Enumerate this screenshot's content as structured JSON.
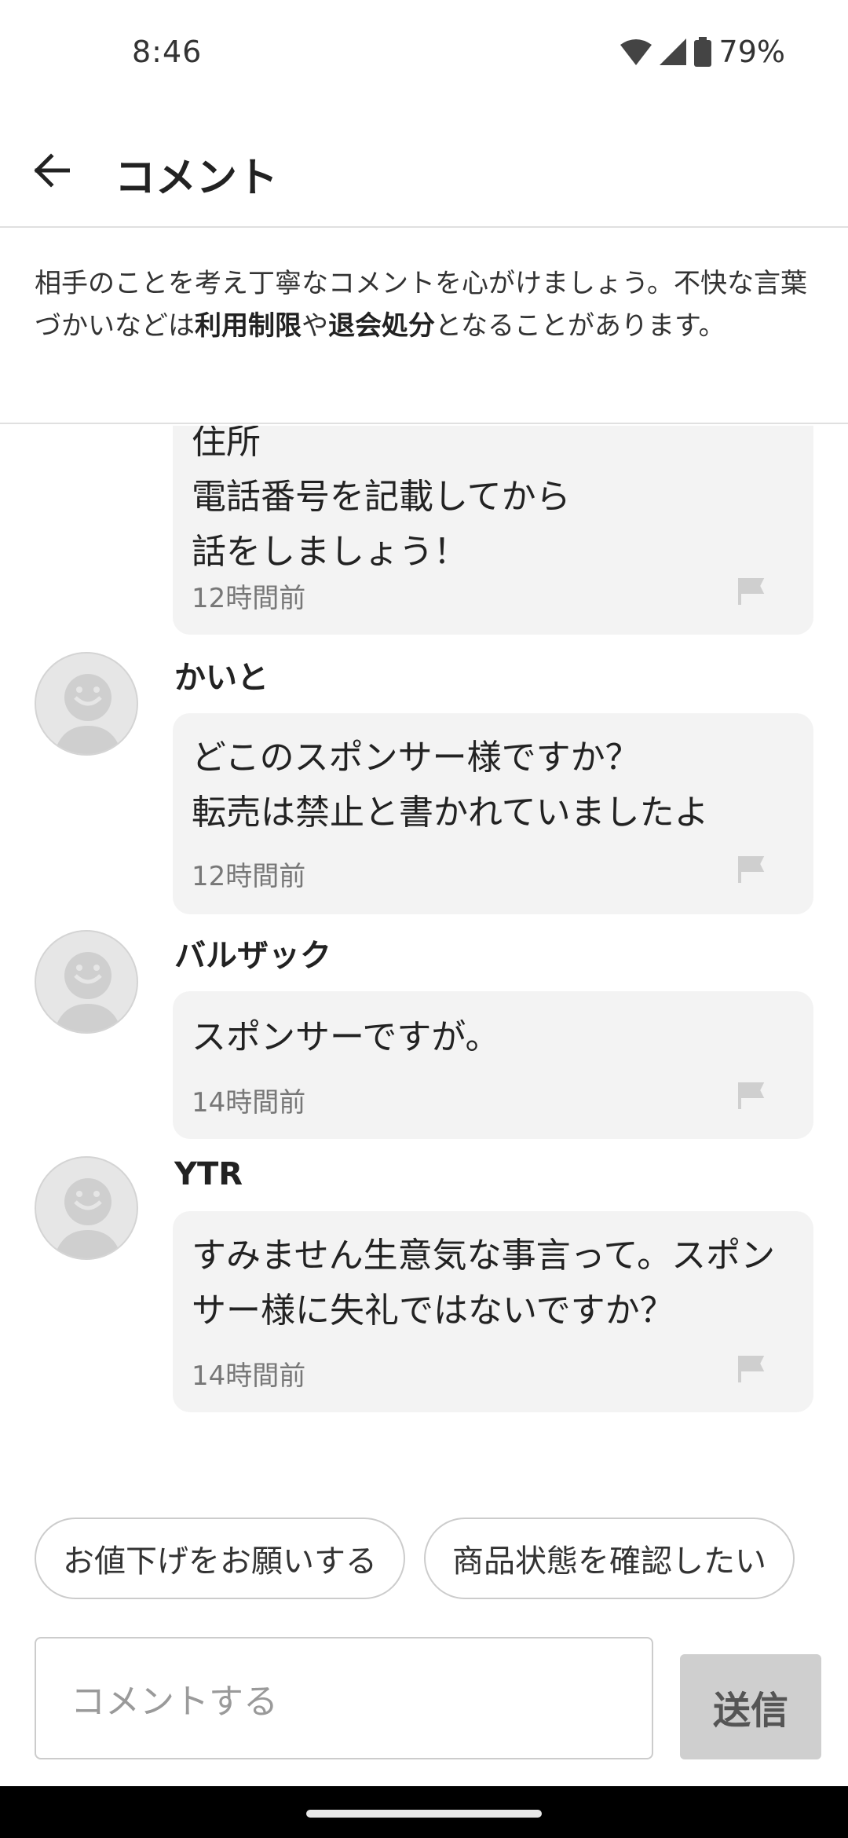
{
  "status_bar": {
    "time": "8:46",
    "battery": "79%"
  },
  "app_bar": {
    "title": "コメント"
  },
  "notice": {
    "part1": "相手のことを考え丁寧なコメントを心がけましょう。不快な言葉づかいなどは",
    "bold1": "利用制限",
    "part2": "や",
    "bold2": "退会処分",
    "part3": "となることがあります。"
  },
  "comments": [
    {
      "username": "",
      "text": "住所\n電話番号を記載してから\n話をしましょう！",
      "time": "12時間前"
    },
    {
      "username": "かいと",
      "text": "どこのスポンサー様ですか？\n転売は禁止と書かれていましたよ",
      "time": "12時間前"
    },
    {
      "username": "バルザック",
      "text": "スポンサーですが。",
      "time": "14時間前"
    },
    {
      "username": "YTR",
      "text": "すみません生意気な事言って。スポンサー様に失礼ではないですか？",
      "time": "14時間前"
    }
  ],
  "quick_replies": [
    "お値下げをお願いする",
    "商品状態を確認したい"
  ],
  "input": {
    "placeholder": "コメントする"
  },
  "send_button": {
    "label": "送信"
  },
  "colors": {
    "bubble": "#f3f3f3",
    "send_disabled": "#cfcfcf",
    "avatar": "#e6e6e6"
  }
}
